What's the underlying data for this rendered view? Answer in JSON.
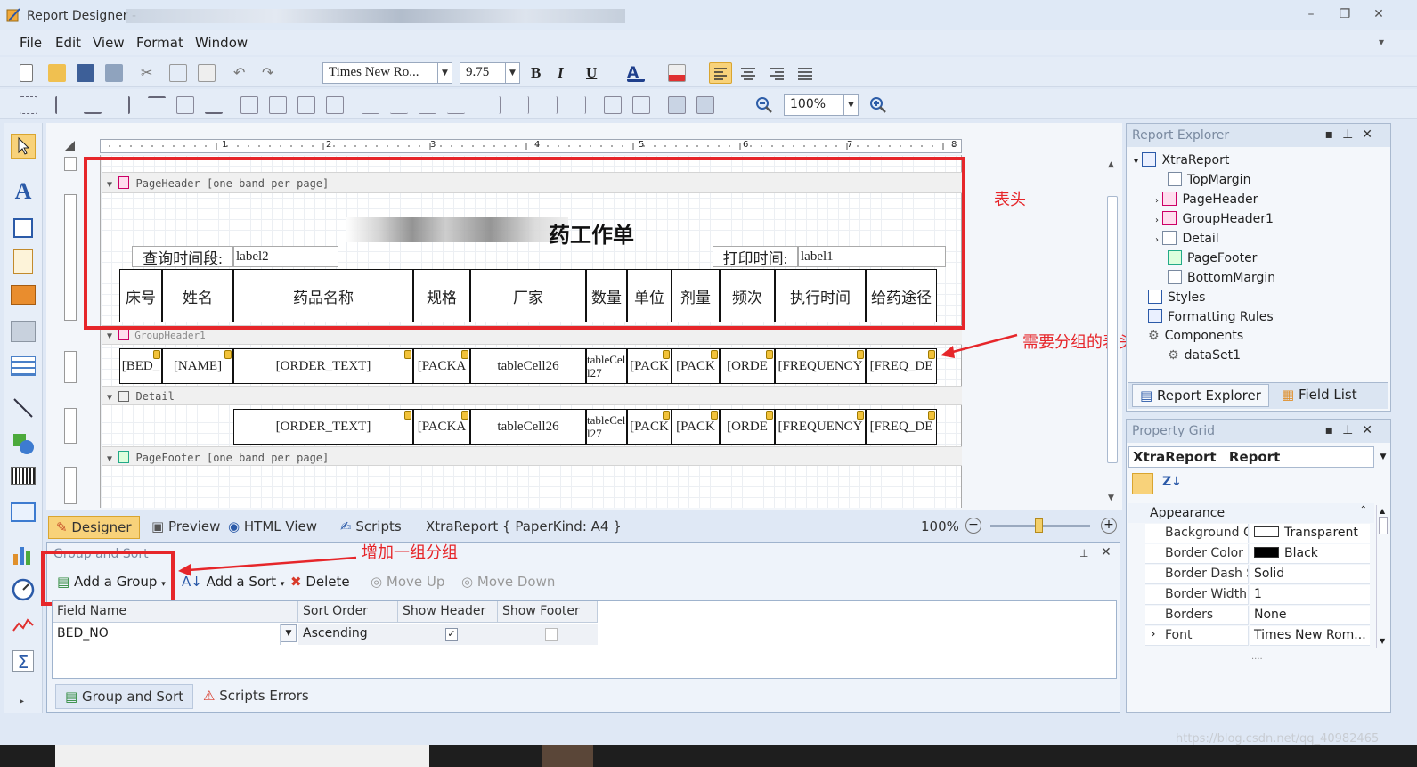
{
  "window": {
    "title": "Report Designer -"
  },
  "menu": [
    "File",
    "Edit",
    "View",
    "Format",
    "Window"
  ],
  "toolbar": {
    "font_family": "Times New Ro...",
    "font_size": "9.75",
    "bold": "B",
    "italic": "I",
    "underline": "U",
    "zoom": "100%"
  },
  "ruler": {
    "marks": [
      "1",
      "2",
      "3",
      "4",
      "5",
      "6",
      "7",
      "8"
    ]
  },
  "bands": {
    "page_header": "PageHeader [one band per page]",
    "group_header": "GroupHeader1",
    "detail": "Detail",
    "page_footer": "PageFooter [one band per page]"
  },
  "header": {
    "title": "药工作单",
    "query_label": "查询时间段:",
    "query_value": "label2",
    "print_label": "打印时间:",
    "print_value": "label1",
    "columns": [
      "床号",
      "姓名",
      "药品名称",
      "规格",
      "厂家",
      "数量",
      "单位",
      "剂量",
      "频次",
      "执行时间",
      "给药途径"
    ]
  },
  "group_row": [
    "[BED_",
    "[NAME]",
    "[ORDER_TEXT]",
    "[PACKA",
    "tableCell26",
    "tableCell27",
    "[PACK",
    "[PACK",
    "[ORDE",
    "[FREQUENCY",
    "[FREQ_DE"
  ],
  "detail_row": [
    "[ORDER_TEXT]",
    "[PACKA",
    "tableCell26",
    "tableCell27",
    "[PACK",
    "[PACK",
    "[ORDE",
    "[FREQUENCY",
    "[FREQ_DE"
  ],
  "annotations": {
    "header": "表头",
    "group_header": "需要分组的表头",
    "add_group": "增加一组分组"
  },
  "designer_tabs": [
    "Designer",
    "Preview",
    "HTML View",
    "Scripts"
  ],
  "designer_status": "XtraReport { PaperKind: A4 }",
  "designer_zoom": "100%",
  "group_sort": {
    "title": "Group and Sort",
    "add_group": "Add a Group",
    "add_sort": "Add a Sort",
    "delete": "Delete",
    "move_up": "Move Up",
    "move_down": "Move Down",
    "columns": [
      "Field Name",
      "Sort Order",
      "Show Header",
      "Show Footer"
    ],
    "row": {
      "field": "BED_NO",
      "order": "Ascending",
      "show_header": true,
      "show_footer": false
    },
    "bottom_tabs": [
      "Group and Sort",
      "Scripts Errors"
    ]
  },
  "explorer": {
    "title": "Report Explorer",
    "root": "XtraReport",
    "items": [
      "TopMargin",
      "PageHeader",
      "GroupHeader1",
      "Detail",
      "PageFooter",
      "BottomMargin"
    ],
    "styles": "Styles",
    "formatting_rules": "Formatting Rules",
    "components": "Components",
    "dataset": "dataSet1",
    "tabs": [
      "Report Explorer",
      "Field List"
    ]
  },
  "property_grid": {
    "title": "Property Grid",
    "object": "XtraReport",
    "object_type": "Report",
    "category": "Appearance",
    "rows": [
      {
        "k": "Background C",
        "v": "Transparent",
        "swatch": "#ffffff"
      },
      {
        "k": "Border Color",
        "v": "Black",
        "swatch": "#000000"
      },
      {
        "k": "Border Dash S",
        "v": "Solid"
      },
      {
        "k": "Border Width",
        "v": "1"
      },
      {
        "k": "Borders",
        "v": "None"
      },
      {
        "k": "Font",
        "v": "Times New Rom..."
      }
    ]
  },
  "watermark": "https://blog.csdn.net/qq_40982465"
}
